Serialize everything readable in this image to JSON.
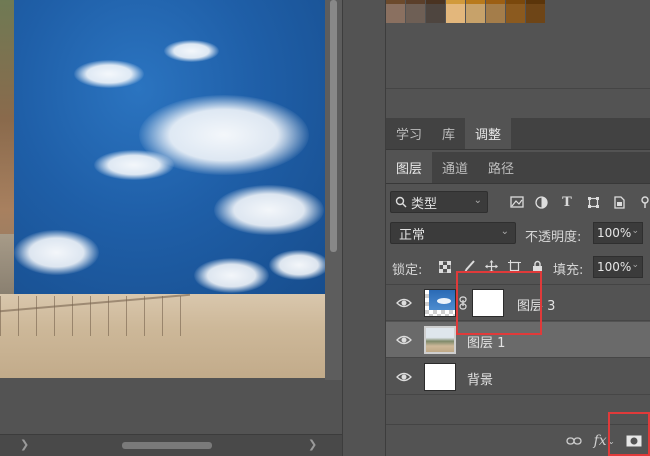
{
  "colors": {
    "swatches_row1": [
      "#8a7060",
      "#6e5f55",
      "#4e453f",
      "#e3b77c",
      "#c7a26a",
      "#a47d4a",
      "#8b5a1f",
      "#6e4517"
    ],
    "swatches_row0": [
      "#6c4a2c",
      "#5b3f2a",
      "#4a3321",
      "#d19a3c",
      "#b87a1c",
      "#9c5f14",
      "#7a480c",
      "#5b350a"
    ],
    "highlight": "#e03a3a"
  },
  "panel_tabs": {
    "top": [
      {
        "label": "学习"
      },
      {
        "label": "库"
      },
      {
        "label": "调整"
      }
    ],
    "layers": [
      {
        "label": "图层"
      },
      {
        "label": "通道"
      },
      {
        "label": "路径"
      }
    ]
  },
  "filter": {
    "kind_label": "类型",
    "icons": [
      "image-filter-icon",
      "adjustment-filter-icon",
      "type-filter-icon",
      "shape-filter-icon",
      "smart-object-filter-icon"
    ]
  },
  "blend": {
    "mode": "正常",
    "opacity_label": "不透明度:",
    "opacity_value": "100%"
  },
  "lock": {
    "label": "锁定:",
    "fill_label": "填充:",
    "fill_value": "100%"
  },
  "layers": [
    {
      "name": "图层 3",
      "has_mask": true,
      "selected": false
    },
    {
      "name": "图层 1",
      "has_mask": false,
      "selected": true
    },
    {
      "name": "背景",
      "has_mask": false,
      "selected": false
    }
  ],
  "bottom_icons": [
    "link-layers-icon",
    "fx-icon",
    "add-mask-icon"
  ],
  "bottom_labels": {
    "fx": "fx"
  }
}
